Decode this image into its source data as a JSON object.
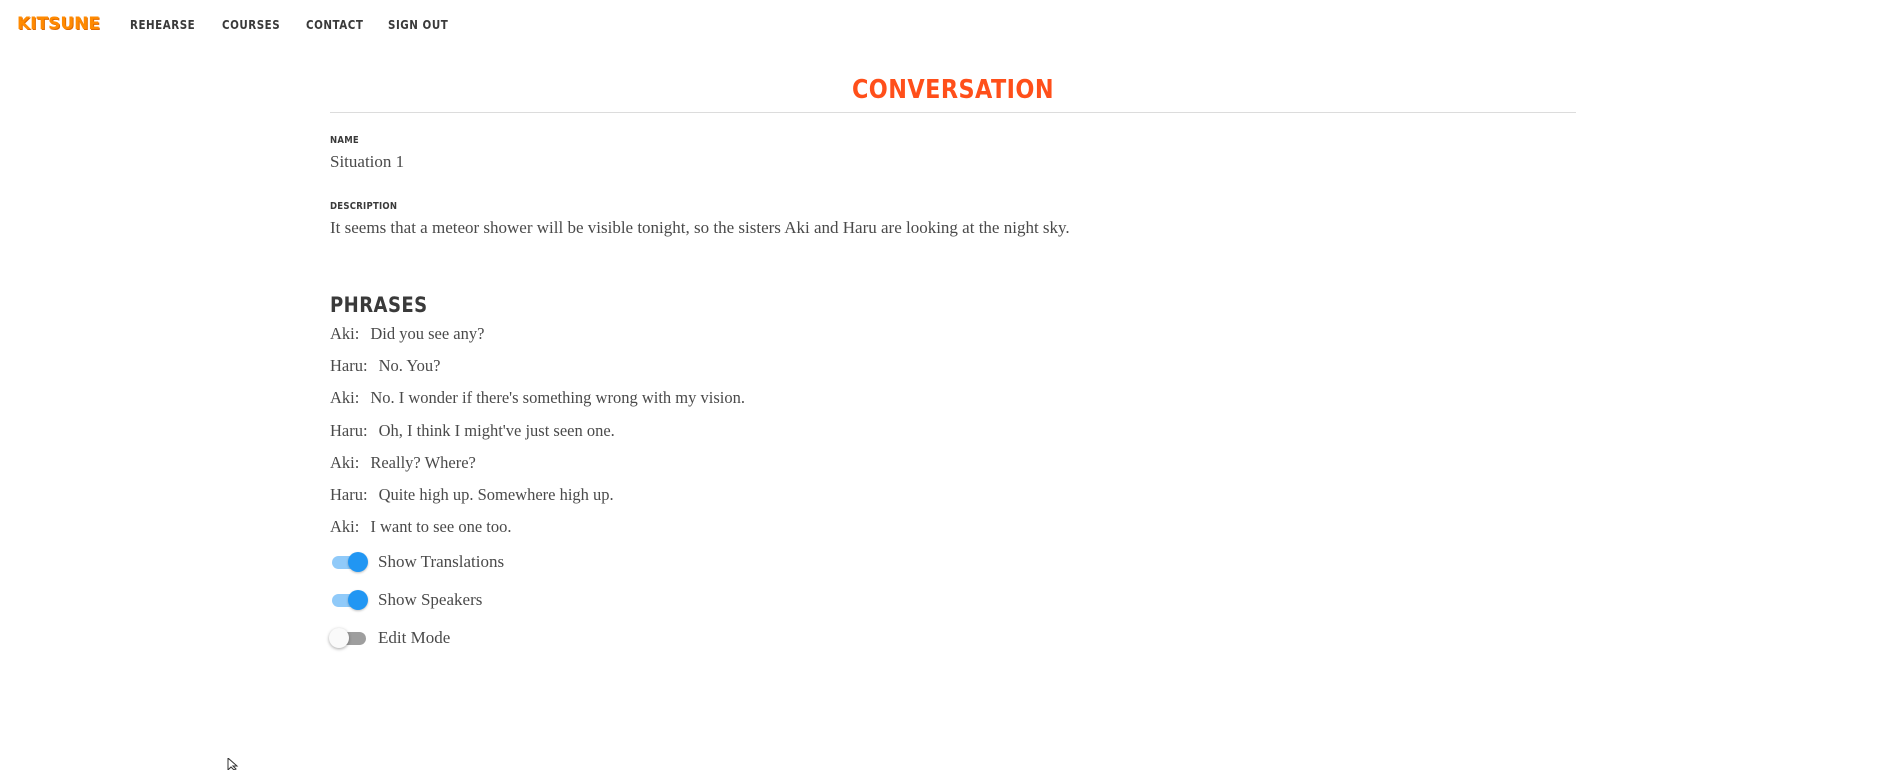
{
  "nav": {
    "brand": "KITSUNE",
    "links": [
      "REHEARSE",
      "COURSES",
      "CONTACT",
      "SIGN OUT"
    ]
  },
  "page": {
    "title": "CONVERSATION"
  },
  "fields": {
    "name_label": "NAME",
    "name_value": "Situation 1",
    "description_label": "DESCRIPTION",
    "description_value": "It seems that a meteor shower will be visible tonight, so the sisters Aki and Haru are looking at the night sky."
  },
  "phrases": {
    "heading": "PHRASES",
    "items": [
      {
        "speaker": "Aki:",
        "text": "Did you see any?"
      },
      {
        "speaker": "Haru:",
        "text": "No. You?"
      },
      {
        "speaker": "Aki:",
        "text": "No. I wonder if there's something wrong with my vision."
      },
      {
        "speaker": "Haru:",
        "text": "Oh, I think I might've just seen one."
      },
      {
        "speaker": "Aki:",
        "text": "Really? Where?"
      },
      {
        "speaker": "Haru:",
        "text": "Quite high up. Somewhere high up."
      },
      {
        "speaker": "Aki:",
        "text": "I want to see one too."
      }
    ]
  },
  "toggles": [
    {
      "label": "Show Translations",
      "on": true
    },
    {
      "label": "Show Speakers",
      "on": true
    },
    {
      "label": "Edit Mode",
      "on": false
    }
  ],
  "colors": {
    "brand": "#ff8a00",
    "title": "#ff4f1a",
    "switch_on": "#2196f3",
    "switch_on_track": "#90caf9",
    "switch_off_track": "#9e9e9e"
  },
  "icons": {
    "cursor": "mouse-pointer-icon"
  }
}
